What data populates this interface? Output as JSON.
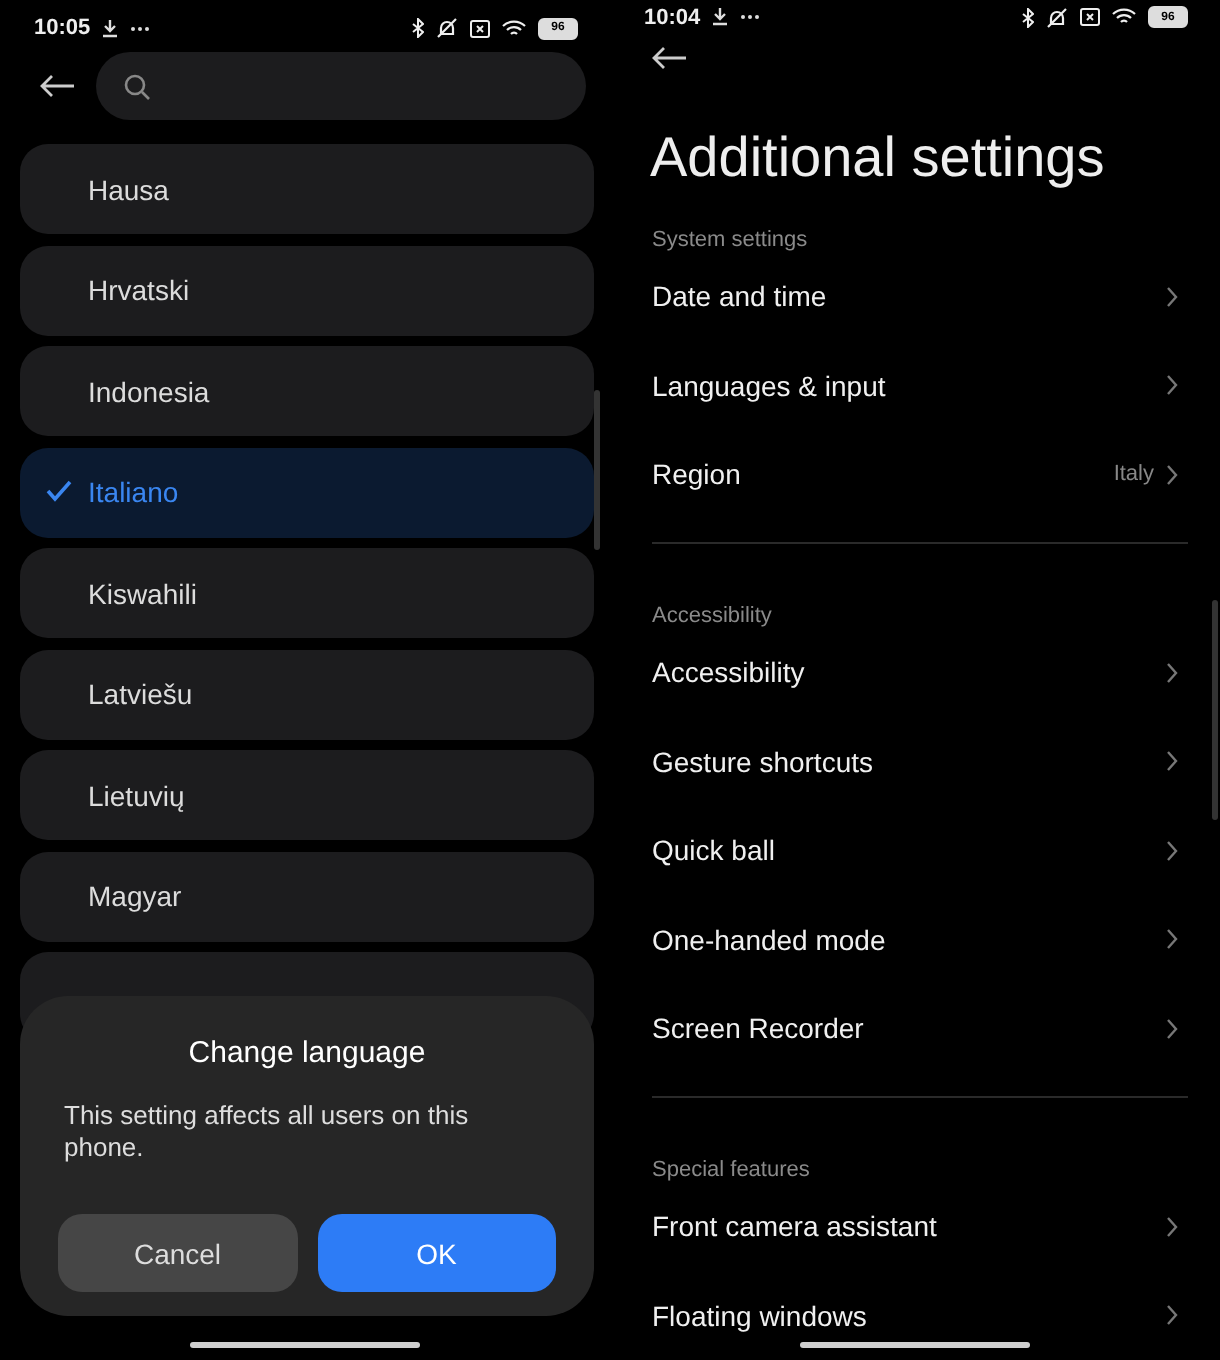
{
  "left_screen": {
    "status_bar": {
      "time": "10:05",
      "battery": "96"
    },
    "languages": [
      {
        "label": "Hausa",
        "selected": false
      },
      {
        "label": "Hrvatski",
        "selected": false
      },
      {
        "label": "Indonesia",
        "selected": false
      },
      {
        "label": "Italiano",
        "selected": true
      },
      {
        "label": "Kiswahili",
        "selected": false
      },
      {
        "label": "Latviešu",
        "selected": false
      },
      {
        "label": "Lietuvių",
        "selected": false
      },
      {
        "label": "Magyar",
        "selected": false
      }
    ],
    "dialog": {
      "title": "Change language",
      "message": "This setting affects all users on this phone.",
      "buttons": [
        {
          "label": "Cancel",
          "kind": "secondary"
        },
        {
          "label": "OK",
          "kind": "primary"
        }
      ]
    }
  },
  "right_screen": {
    "status_bar": {
      "time": "10:04",
      "battery": "96"
    },
    "title": "Additional settings",
    "sections": [
      {
        "header": "System settings",
        "items": [
          {
            "label": "Date and time"
          },
          {
            "label": "Languages & input"
          },
          {
            "label": "Region",
            "value": "Italy"
          }
        ]
      },
      {
        "header": "Accessibility",
        "items": [
          {
            "label": "Accessibility"
          },
          {
            "label": "Gesture shortcuts"
          },
          {
            "label": "Quick ball"
          },
          {
            "label": "One-handed mode"
          },
          {
            "label": "Screen Recorder"
          }
        ]
      },
      {
        "header": "Special features",
        "items": [
          {
            "label": "Front camera assistant"
          },
          {
            "label": "Floating windows"
          }
        ]
      }
    ]
  }
}
